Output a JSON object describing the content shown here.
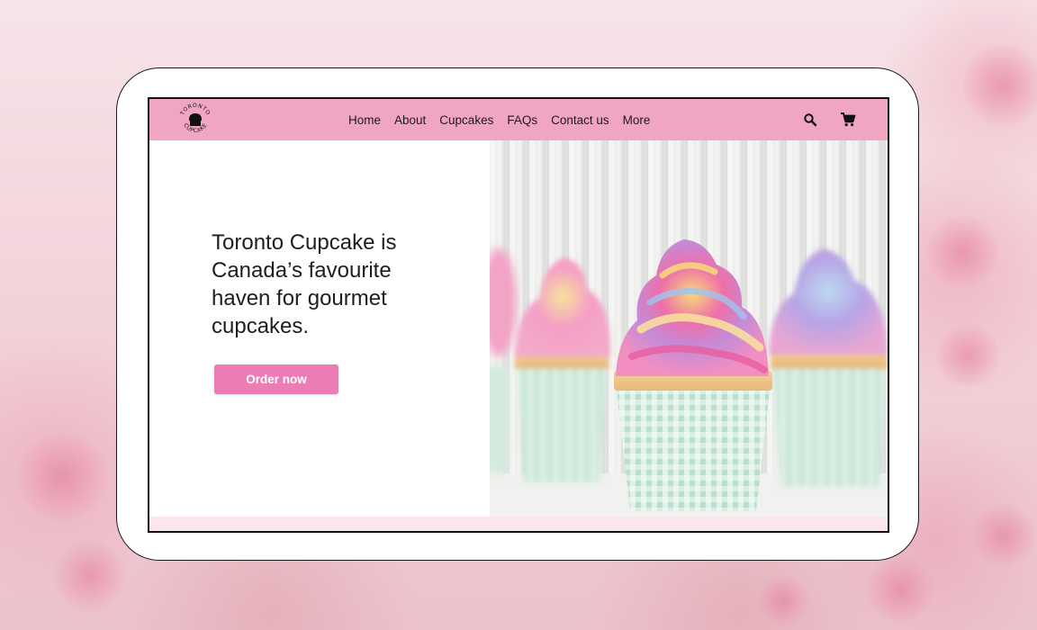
{
  "brand": {
    "logo_text": "TORONTO CUPCAKE"
  },
  "nav": {
    "links": [
      "Home",
      "About",
      "Cupcakes",
      "FAQs",
      "Contact us",
      "More"
    ],
    "search_icon": "search-icon",
    "cart_icon": "cart-icon"
  },
  "hero": {
    "headline": "Toronto Cupcake is Canada’s favourite haven for gourmet cupcakes.",
    "cta_label": "Order now",
    "image": "cupcakes-photo"
  },
  "colors": {
    "navbar": "#f0a5c3",
    "cta": "#ec7cb4",
    "strip": "#fbe6ef"
  }
}
